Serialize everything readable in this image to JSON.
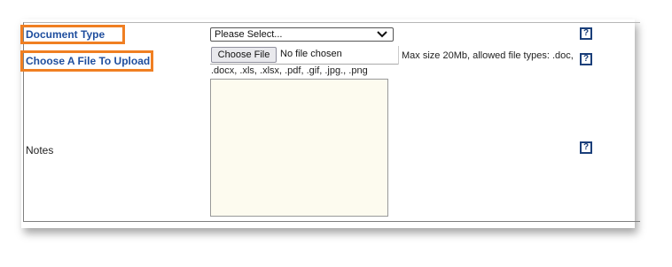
{
  "form": {
    "document_type_label": "Document Type",
    "document_type_select": {
      "selected": "Please Select..."
    },
    "file_label": "Choose A File To Upload",
    "file_button_label": "Choose File",
    "file_status": "No file chosen",
    "file_hint_line1": "Max size 20Mb, allowed file types: .doc,",
    "file_hint_line2": ".docx, .xls, .xlsx, .pdf, .gif, .jpg., .png",
    "notes_label": "Notes",
    "notes_value": "",
    "help_glyph": "?"
  },
  "colors": {
    "label_blue": "#1f4e9e",
    "highlight_orange": "#f07f22",
    "help_icon": "#1b3f7a",
    "textarea_bg": "#fdfbef"
  }
}
